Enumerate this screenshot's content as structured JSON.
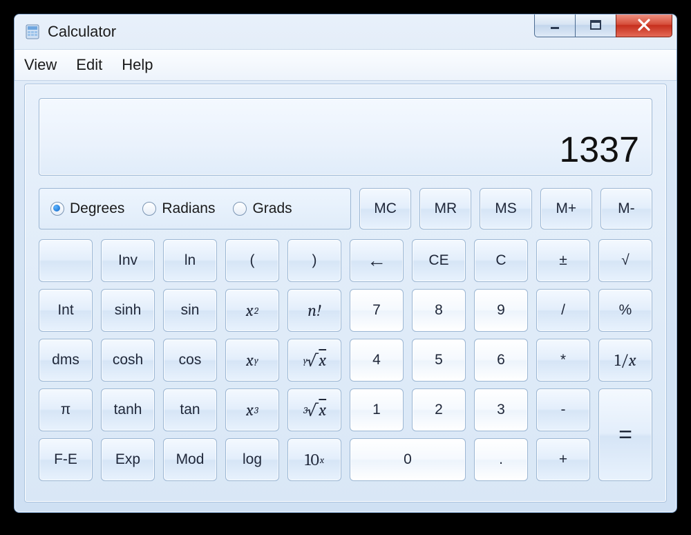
{
  "window": {
    "title": "Calculator"
  },
  "menu": {
    "view": "View",
    "edit": "Edit",
    "help": "Help"
  },
  "display": {
    "value": "1337"
  },
  "angle": {
    "degrees": "Degrees",
    "radians": "Radians",
    "grads": "Grads",
    "selected": "degrees"
  },
  "memory": {
    "mc": "MC",
    "mr": "MR",
    "ms": "MS",
    "mplus": "M+",
    "mminus": "M-"
  },
  "keys": {
    "blank": "",
    "inv": "Inv",
    "ln": "ln",
    "lparen": "(",
    "rparen": ")",
    "back": "←",
    "ce": "CE",
    "c": "C",
    "pm": "±",
    "sqrt": "√",
    "int": "Int",
    "sinh": "sinh",
    "sin": "sin",
    "x2": "x",
    "x2sup": "2",
    "fact": "n!",
    "k7": "7",
    "k8": "8",
    "k9": "9",
    "div": "/",
    "pct": "%",
    "dms": "dms",
    "cosh": "cosh",
    "cos": "cos",
    "xy": "x",
    "xysup": "y",
    "yroot_pre": "y",
    "yroot_post": "x",
    "k4": "4",
    "k5": "5",
    "k6": "6",
    "mul": "*",
    "inv1x_pre": "1/",
    "inv1x_post": "x",
    "pi": "π",
    "tanh": "tanh",
    "tan": "tan",
    "x3": "x",
    "x3sup": "3",
    "cbrt_pre": "3",
    "cbrt_post": "x",
    "k1": "1",
    "k2": "2",
    "k3": "3",
    "sub": "-",
    "eq": "=",
    "fe": "F-E",
    "exp": "Exp",
    "mod": "Mod",
    "log": "log",
    "tenx_pre": "10",
    "tenx_sup": "x",
    "k0": "0",
    "dot": ".",
    "add": "+"
  }
}
